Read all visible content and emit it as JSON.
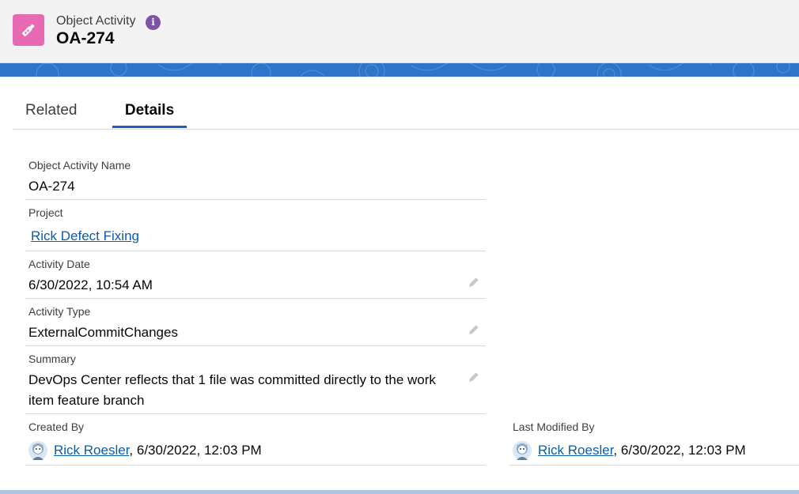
{
  "header": {
    "object_type": "Object Activity",
    "record_name": "OA-274",
    "info_icon_glyph": "i",
    "icon": "data-object-icon",
    "icon_color": "#e769b4"
  },
  "tabs": {
    "related": "Related",
    "details": "Details",
    "active": "Details",
    "accent_color": "#1b5fc1"
  },
  "fields": {
    "name": {
      "label": "Object Activity Name",
      "value": "OA-274"
    },
    "project": {
      "label": "Project",
      "value": "Rick Defect Fixing"
    },
    "activity_date": {
      "label": "Activity Date",
      "value": "6/30/2022, 10:54 AM"
    },
    "activity_type": {
      "label": "Activity Type",
      "value": "ExternalCommitChanges"
    },
    "summary": {
      "label": "Summary",
      "value": "DevOps Center reflects that 1 file was committed directly to the work item feature branch"
    },
    "created_by": {
      "label": "Created By",
      "user": "Rick Roesler",
      "date": ", 6/30/2022, 12:03 PM"
    },
    "last_modified_by": {
      "label": "Last Modified By",
      "user": "Rick Roesler",
      "date": ", 6/30/2022, 12:03 PM"
    }
  },
  "colors": {
    "link": "#0b5cab",
    "banner": "#2e74c8"
  }
}
